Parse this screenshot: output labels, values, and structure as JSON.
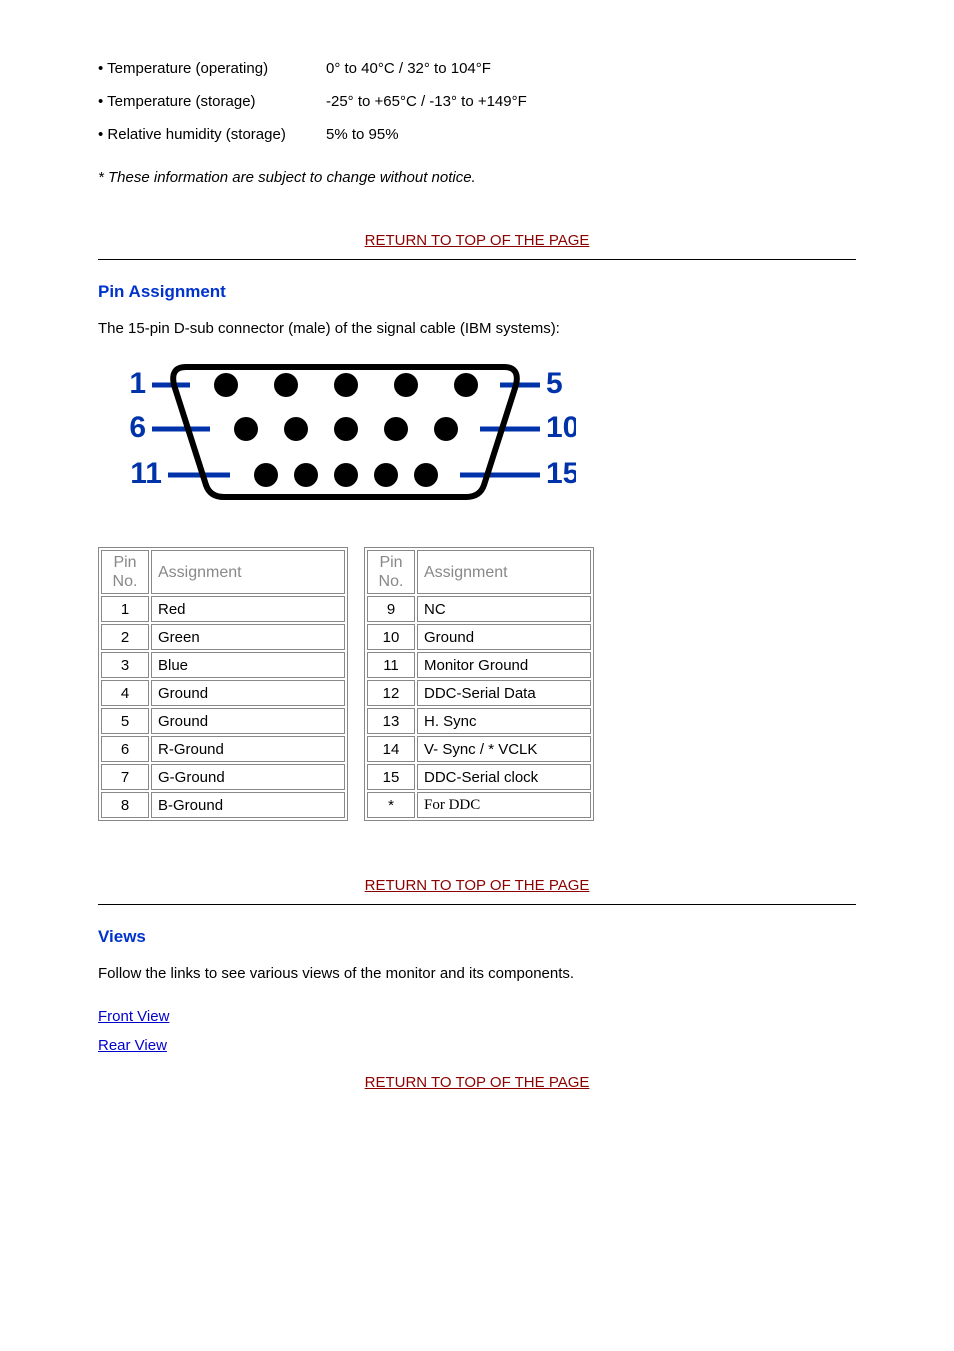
{
  "specs": [
    {
      "label": "• Temperature (operating)",
      "value": "0° to 40°C / 32° to 104°F"
    },
    {
      "label": "• Temperature (storage)",
      "value": "-25° to +65°C / -13° to +149°F"
    },
    {
      "label": "• Relative humidity (storage)",
      "value": "5% to 95%"
    }
  ],
  "note": "* These information are subject to change without notice.",
  "return_link": "RETURN TO TOP OF THE PAGE",
  "pin_section": {
    "heading": "Pin Assignment",
    "desc": "The 15-pin D-sub connector (male) of the signal cable (IBM systems):",
    "diagram_numbers": {
      "l1": "1",
      "l2": "6",
      "l3": "11",
      "r1": "5",
      "r2": "10",
      "r3": "15"
    },
    "header_pin": "Pin No.",
    "header_assign": "Assignment",
    "left_pins": [
      {
        "no": "1",
        "assign": "Red"
      },
      {
        "no": "2",
        "assign": "Green"
      },
      {
        "no": "3",
        "assign": "Blue"
      },
      {
        "no": "4",
        "assign": "Ground"
      },
      {
        "no": "5",
        "assign": "Ground"
      },
      {
        "no": "6",
        "assign": "R-Ground"
      },
      {
        "no": "7",
        "assign": "G-Ground"
      },
      {
        "no": "8",
        "assign": "B-Ground"
      }
    ],
    "right_pins": [
      {
        "no": "9",
        "assign": "NC"
      },
      {
        "no": "10",
        "assign": "Ground"
      },
      {
        "no": "11",
        "assign": "Monitor Ground"
      },
      {
        "no": "12",
        "assign": "DDC-Serial Data"
      },
      {
        "no": "13",
        "assign": "H. Sync"
      },
      {
        "no": "14",
        "assign": "V- Sync / * VCLK"
      },
      {
        "no": "15",
        "assign": "DDC-Serial clock"
      },
      {
        "no": "*",
        "assign": "For DDC"
      }
    ]
  },
  "views_section": {
    "heading": "Views",
    "desc": "Follow the links to see various views of the monitor and its components.",
    "front": "Front View",
    "rear": "Rear View"
  }
}
